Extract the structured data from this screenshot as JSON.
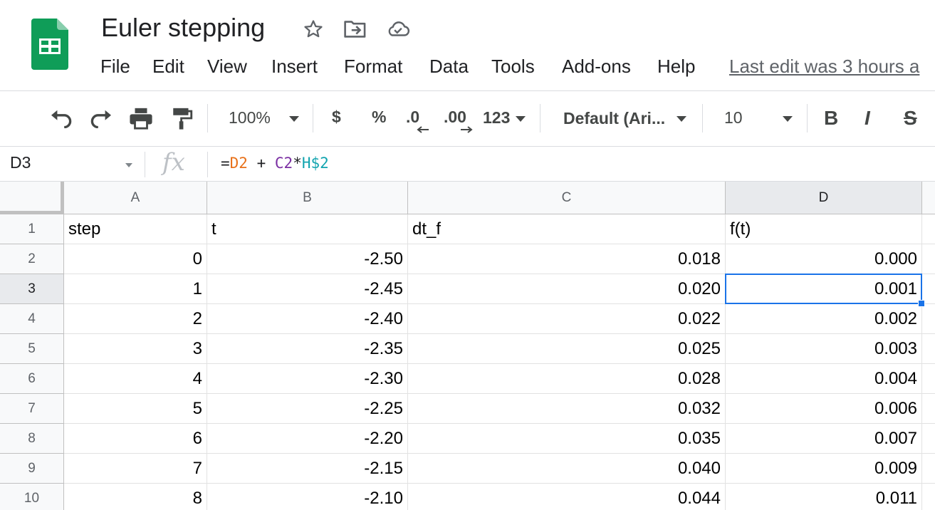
{
  "app": {
    "doc_title": "Euler stepping",
    "last_edit": "Last edit was 3 hours a",
    "brand_color": "#0f9d58"
  },
  "title_icons": [
    "star-icon",
    "move-to-folder-icon",
    "cloud-saved-icon"
  ],
  "menu": [
    "File",
    "Edit",
    "View",
    "Insert",
    "Format",
    "Data",
    "Tools",
    "Add-ons",
    "Help"
  ],
  "toolbar": {
    "zoom": "100%",
    "currency": "$",
    "percent": "%",
    "decrease_decimals": ".0",
    "increase_decimals": ".00",
    "more_formats": "123",
    "font": "Default (Ari...",
    "font_size": "10",
    "bold": "B",
    "italic": "I",
    "strikethrough": "S"
  },
  "formula_bar": {
    "name_box": "D3",
    "fx": "fx",
    "formula_parts": [
      {
        "text": "=",
        "color": "#202124"
      },
      {
        "text": "D2",
        "color": "#e8711a"
      },
      {
        "text": " + ",
        "color": "#202124"
      },
      {
        "text": "C2",
        "color": "#7b2fa3"
      },
      {
        "text": "*",
        "color": "#202124"
      },
      {
        "text": "H$2",
        "color": "#12a4af"
      }
    ]
  },
  "grid": {
    "columns": [
      "A",
      "B",
      "C",
      "D"
    ],
    "selected_column": "D",
    "selected_row": "3",
    "rows": [
      {
        "num": "1",
        "cells": [
          "step",
          "t",
          "dt_f",
          "f(t)"
        ],
        "align": "left"
      },
      {
        "num": "2",
        "cells": [
          "0",
          "-2.50",
          "0.018",
          "0.000"
        ]
      },
      {
        "num": "3",
        "cells": [
          "1",
          "-2.45",
          "0.020",
          "0.001"
        ]
      },
      {
        "num": "4",
        "cells": [
          "2",
          "-2.40",
          "0.022",
          "0.002"
        ]
      },
      {
        "num": "5",
        "cells": [
          "3",
          "-2.35",
          "0.025",
          "0.003"
        ]
      },
      {
        "num": "6",
        "cells": [
          "4",
          "-2.30",
          "0.028",
          "0.004"
        ]
      },
      {
        "num": "7",
        "cells": [
          "5",
          "-2.25",
          "0.032",
          "0.006"
        ]
      },
      {
        "num": "8",
        "cells": [
          "6",
          "-2.20",
          "0.035",
          "0.007"
        ]
      },
      {
        "num": "9",
        "cells": [
          "7",
          "-2.15",
          "0.040",
          "0.009"
        ]
      },
      {
        "num": "10",
        "cells": [
          "8",
          "-2.10",
          "0.044",
          "0.011"
        ]
      }
    ]
  }
}
